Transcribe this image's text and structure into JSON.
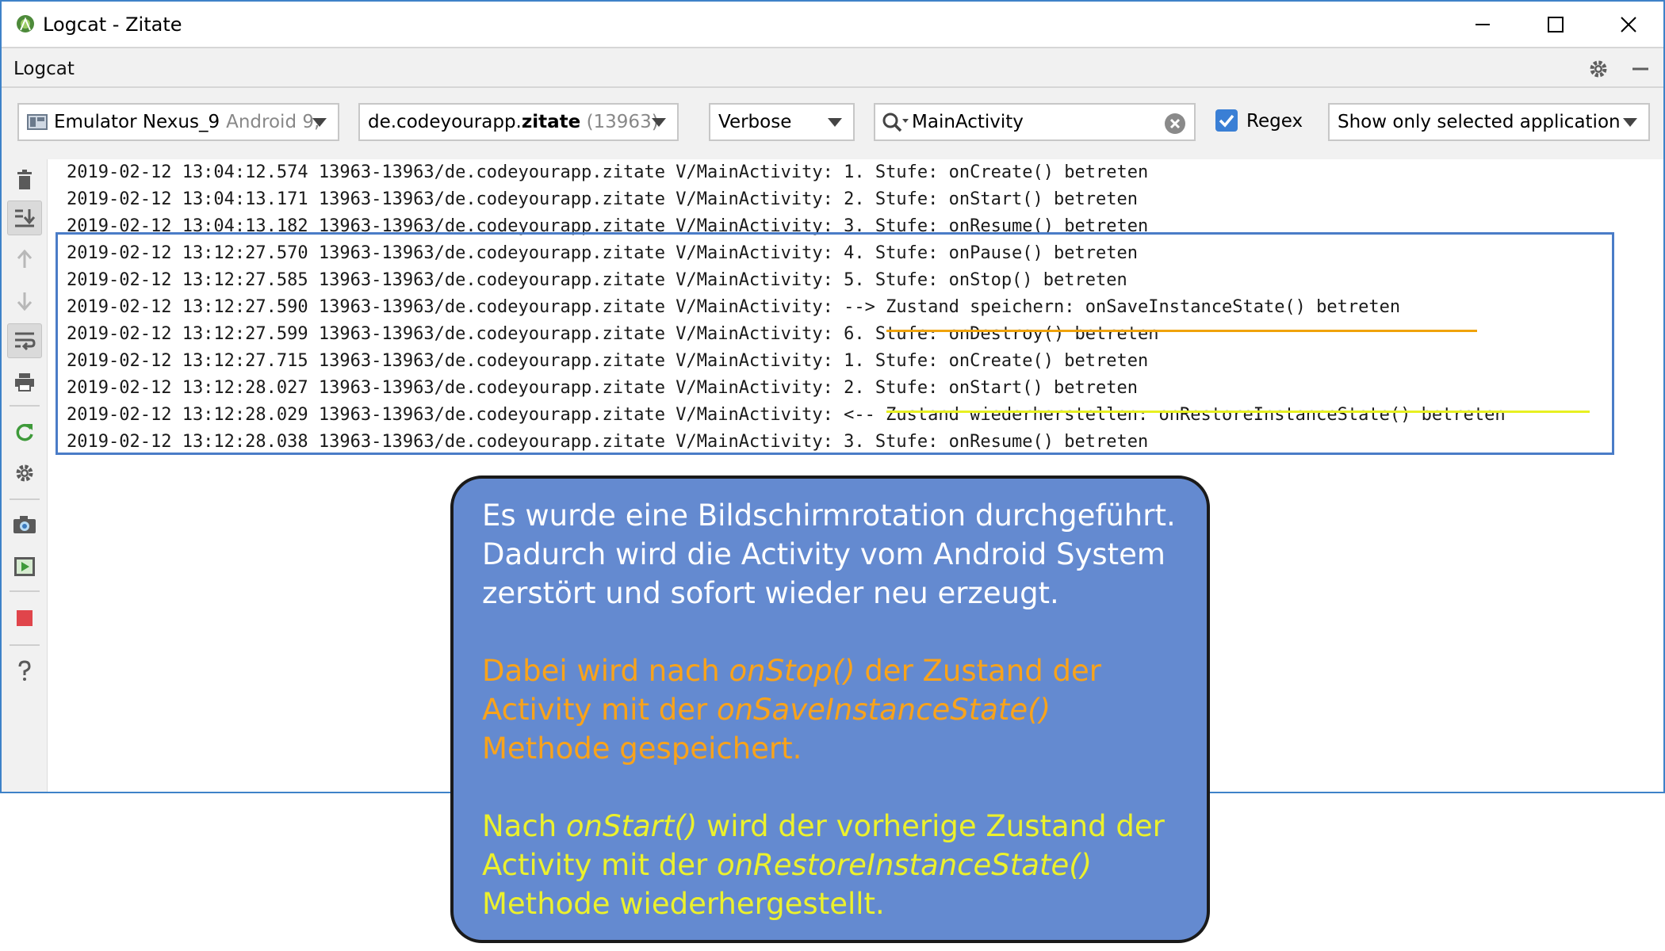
{
  "window": {
    "title": "Logcat - Zitate",
    "tool_window_title": "Logcat"
  },
  "filters": {
    "device": {
      "name": "Emulator Nexus_9",
      "detail": "Android 9,"
    },
    "process": {
      "package_prefix": "de.codeyourapp.",
      "package_name": "zitate",
      "pid": "(13963)"
    },
    "log_level": "Verbose",
    "search_value": "MainActivity",
    "regex_label": "Regex",
    "regex_checked": true,
    "scope": "Show only selected application"
  },
  "log_lines": [
    "2019-02-12 13:04:12.574 13963-13963/de.codeyourapp.zitate V/MainActivity: 1. Stufe: onCreate() betreten",
    "2019-02-12 13:04:13.171 13963-13963/de.codeyourapp.zitate V/MainActivity: 2. Stufe: onStart() betreten",
    "2019-02-12 13:04:13.182 13963-13963/de.codeyourapp.zitate V/MainActivity: 3. Stufe: onResume() betreten",
    "2019-02-12 13:12:27.570 13963-13963/de.codeyourapp.zitate V/MainActivity: 4. Stufe: onPause() betreten",
    "2019-02-12 13:12:27.585 13963-13963/de.codeyourapp.zitate V/MainActivity: 5. Stufe: onStop() betreten",
    "2019-02-12 13:12:27.590 13963-13963/de.codeyourapp.zitate V/MainActivity: --> Zustand speichern: onSaveInstanceState() betreten",
    "2019-02-12 13:12:27.599 13963-13963/de.codeyourapp.zitate V/MainActivity: 6. Stufe: onDestroy() betreten",
    "2019-02-12 13:12:27.715 13963-13963/de.codeyourapp.zitate V/MainActivity: 1. Stufe: onCreate() betreten",
    "2019-02-12 13:12:28.027 13963-13963/de.codeyourapp.zitate V/MainActivity: 2. Stufe: onStart() betreten",
    "2019-02-12 13:12:28.029 13963-13963/de.codeyourapp.zitate V/MainActivity: <-- Zustand wiederherstellen: onRestoreInstanceState() betreten",
    "2019-02-12 13:12:28.038 13963-13963/de.codeyourapp.zitate V/MainActivity: 3. Stufe: onResume() betreten"
  ],
  "callout": {
    "p1": "Es wurde eine Bildschirmrotation durchgeführt. Dadurch wird die Activity vom Android System zerstört und sofort wieder neu erzeugt.",
    "p2": {
      "a": "Dabei wird nach ",
      "b": "onStop()",
      "c": " der Zustand der Activity mit der ",
      "d": "onSaveInstanceState()",
      "e": " Methode gespeichert."
    },
    "p3": {
      "a": "Nach ",
      "b": "onStart()",
      "c": " wird der vorherige Zustand der Activity mit der ",
      "d": "onRestoreInstanceState()",
      "e": " Methode wiederhergestellt."
    }
  },
  "colors": {
    "highlight_box": "#4a7cc7",
    "underline_save": "#f0a30a",
    "underline_restore": "#e8f021",
    "callout_bg": "#648ad0",
    "callout_text_orange": "#f9a31b",
    "callout_text_yellow": "#ecf12c",
    "checkbox": "#3a7fd5"
  },
  "icons": {
    "app": "android-studio-icon",
    "settings": "gear-icon",
    "hide": "minimize-panel-icon",
    "sidebar": [
      "trash-icon",
      "scroll-to-end-icon",
      "arrow-up-icon",
      "arrow-down-icon",
      "soft-wrap-icon",
      "print-icon",
      "restart-icon",
      "gear-icon",
      "camera-icon",
      "screen-record-icon",
      "stop-icon",
      "help-icon"
    ]
  }
}
